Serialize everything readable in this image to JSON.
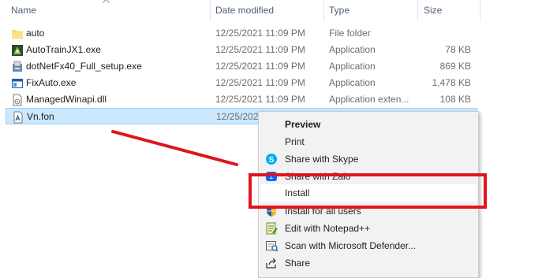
{
  "header": {
    "col_name": "Name",
    "col_date": "Date modified",
    "col_type": "Type",
    "col_size": "Size"
  },
  "files": [
    {
      "name": "auto",
      "date": "12/25/2021 11:09 PM",
      "type": "File folder",
      "size": "",
      "icon": "folder-icon"
    },
    {
      "name": "AutoTrainJX1.exe",
      "date": "12/25/2021 11:09 PM",
      "type": "Application",
      "size": "78 KB",
      "icon": "exe-icon"
    },
    {
      "name": "dotNetFx40_Full_setup.exe",
      "date": "12/25/2021 11:09 PM",
      "type": "Application",
      "size": "869 KB",
      "icon": "setup-icon"
    },
    {
      "name": "FixAuto.exe",
      "date": "12/25/2021 11:09 PM",
      "type": "Application",
      "size": "1,478 KB",
      "icon": "window-icon"
    },
    {
      "name": "ManagedWinapi.dll",
      "date": "12/25/2021 11:09 PM",
      "type": "Application exten...",
      "size": "108 KB",
      "icon": "dll-icon"
    },
    {
      "name": "Vn.fon",
      "date": "12/25/202",
      "type": "",
      "size": "",
      "icon": "font-file-icon",
      "selected": true
    }
  ],
  "context_menu": {
    "items": [
      {
        "label": "Preview",
        "bold": true,
        "icon": ""
      },
      {
        "label": "Print",
        "bold": false,
        "icon": ""
      },
      {
        "label": "Share with Skype",
        "bold": false,
        "icon": "skype-icon"
      },
      {
        "label": "Share with Zalo",
        "bold": false,
        "icon": "zalo-icon"
      },
      {
        "label": "Install",
        "bold": false,
        "icon": "",
        "hover": true
      },
      {
        "label": "Install for all users",
        "bold": false,
        "icon": "shield-icon"
      },
      {
        "label": "Edit with Notepad++",
        "bold": false,
        "icon": "notepad-plus-plus-icon"
      },
      {
        "label": "Scan with Microsoft Defender...",
        "bold": false,
        "icon": "defender-icon"
      },
      {
        "label": "Share",
        "bold": false,
        "icon": "share-icon"
      }
    ]
  },
  "colors": {
    "selection_bg": "#cce8ff",
    "annotation_red": "#e0141e",
    "header_text": "#4c607a"
  }
}
